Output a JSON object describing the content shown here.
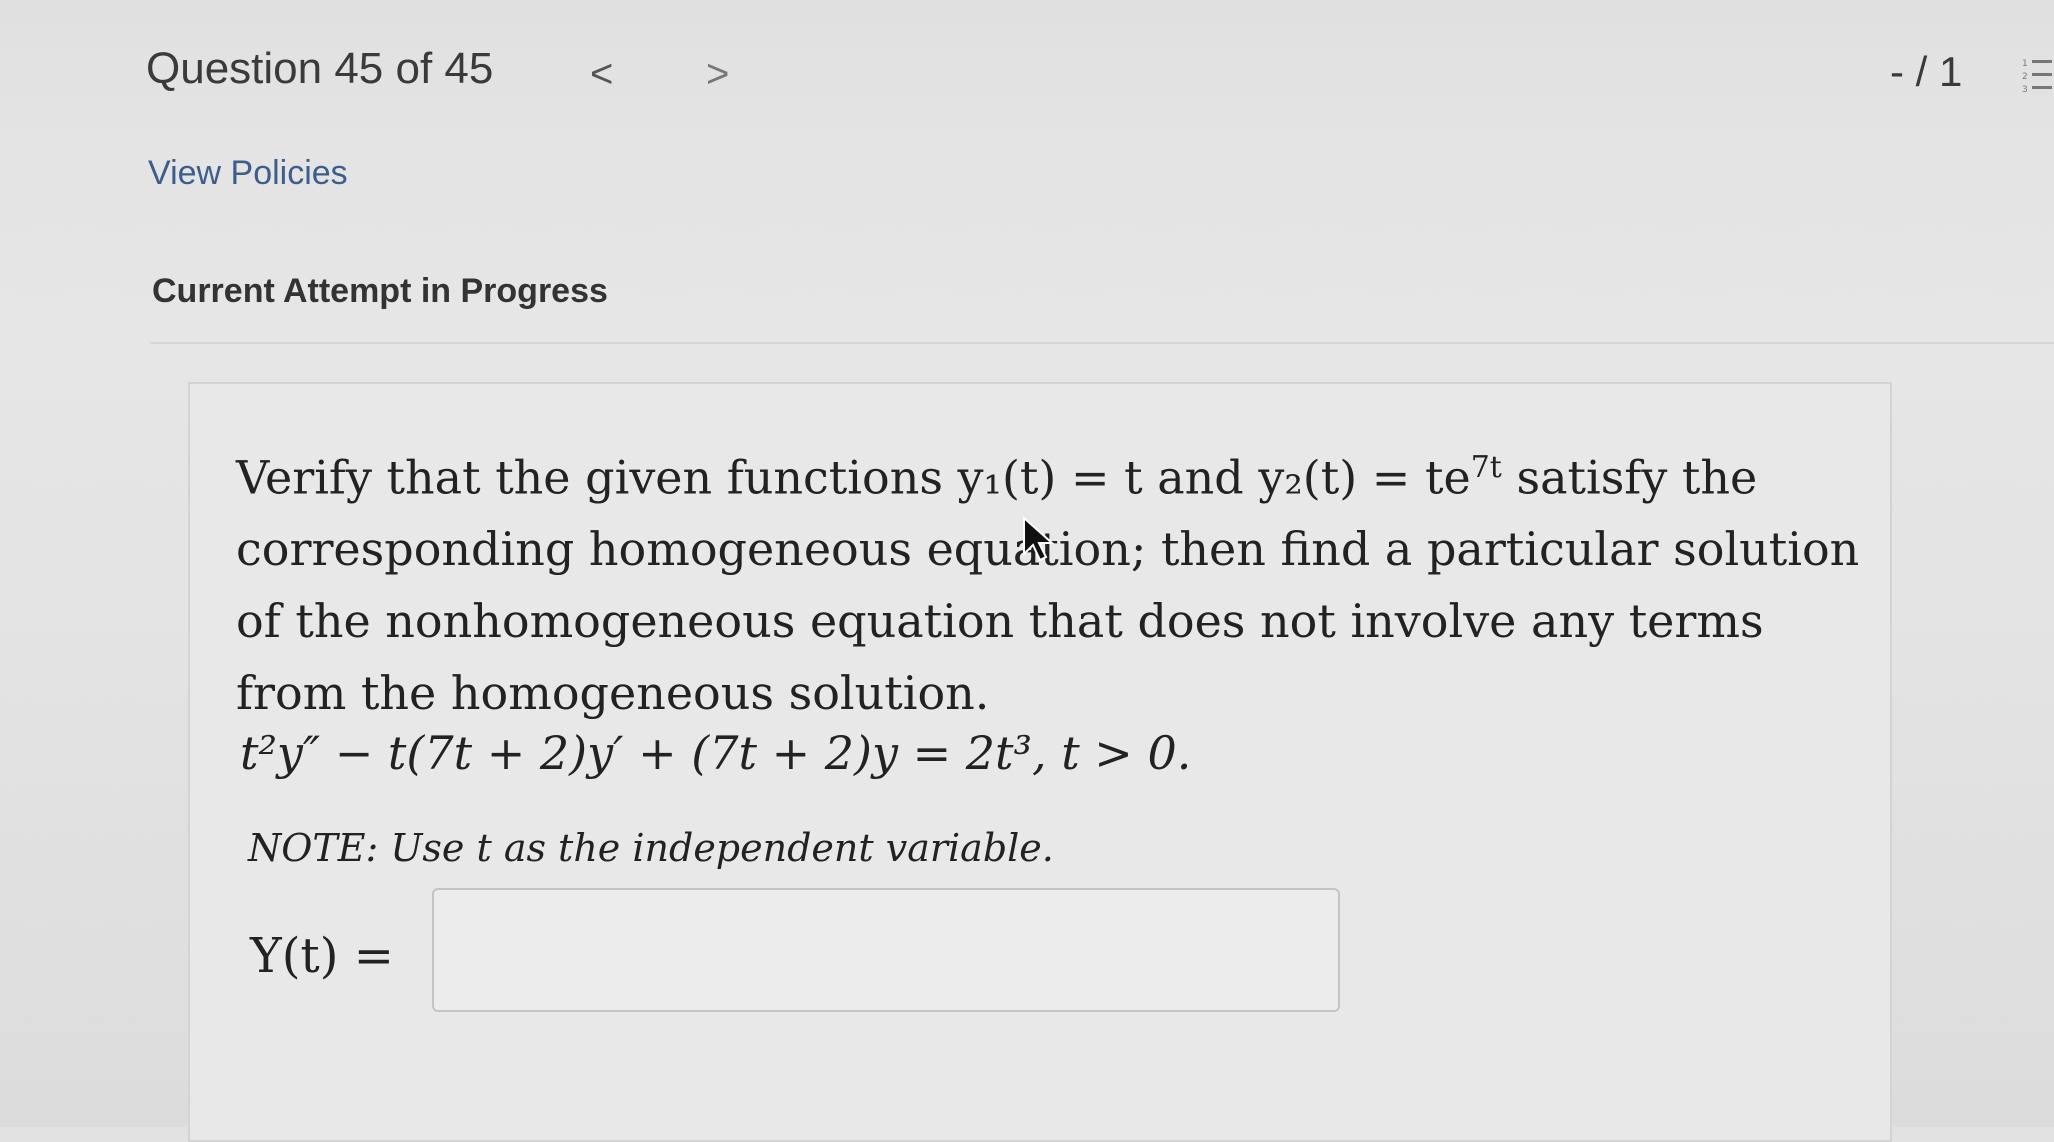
{
  "header": {
    "question_title": "Question 45 of 45",
    "prev_symbol": "<",
    "next_symbol": ">",
    "score": "- / 1"
  },
  "links": {
    "view_policies": "View Policies"
  },
  "attempt_label": "Current Attempt in Progress",
  "problem": {
    "intro": "Verify that the given functions y₁(t) = t and y₂(t) = te",
    "exp": "7t",
    "rest": " satisfy the corresponding homogeneous equation; then find a particular solution of the nonhomogeneous equation that does not involve any terms from the homogeneous solution.",
    "equation": "t²y″ − t(7t + 2)y′ + (7t + 2)y = 2t³, t > 0.",
    "note": "NOTE: Use t as the independent variable.",
    "answer_label": "Y(t) =",
    "answer_value": ""
  },
  "icons": [
    "chevron-left-icon",
    "chevron-right-icon",
    "list-icon",
    "mouse-cursor-icon"
  ]
}
